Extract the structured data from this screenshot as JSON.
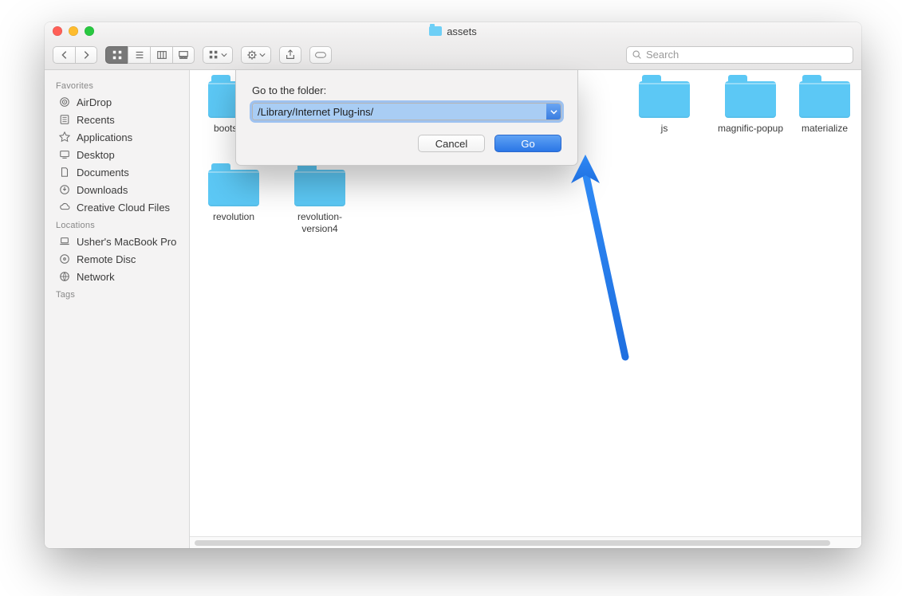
{
  "window": {
    "title": "assets"
  },
  "toolbar": {
    "search_placeholder": "Search"
  },
  "sidebar": {
    "sections": [
      {
        "title": "Favorites",
        "items": [
          {
            "icon": "airdrop",
            "label": "AirDrop"
          },
          {
            "icon": "recents",
            "label": "Recents"
          },
          {
            "icon": "apps",
            "label": "Applications"
          },
          {
            "icon": "desktop",
            "label": "Desktop"
          },
          {
            "icon": "documents",
            "label": "Documents"
          },
          {
            "icon": "downloads",
            "label": "Downloads"
          },
          {
            "icon": "cloud",
            "label": "Creative Cloud Files"
          }
        ]
      },
      {
        "title": "Locations",
        "items": [
          {
            "icon": "laptop",
            "label": "Usher's MacBook Pro"
          },
          {
            "icon": "disc",
            "label": "Remote Disc"
          },
          {
            "icon": "network",
            "label": "Network"
          }
        ]
      },
      {
        "title": "Tags",
        "items": []
      }
    ]
  },
  "files": [
    {
      "name": "bootstrap"
    },
    {
      "name": "js"
    },
    {
      "name": "magnific-popup"
    },
    {
      "name": "materialize"
    },
    {
      "name": "revolution"
    },
    {
      "name": "revolution-version4"
    }
  ],
  "sheet": {
    "label": "Go to the folder:",
    "path_value": "/Library/Internet Plug-ins/",
    "cancel_label": "Cancel",
    "go_label": "Go"
  }
}
